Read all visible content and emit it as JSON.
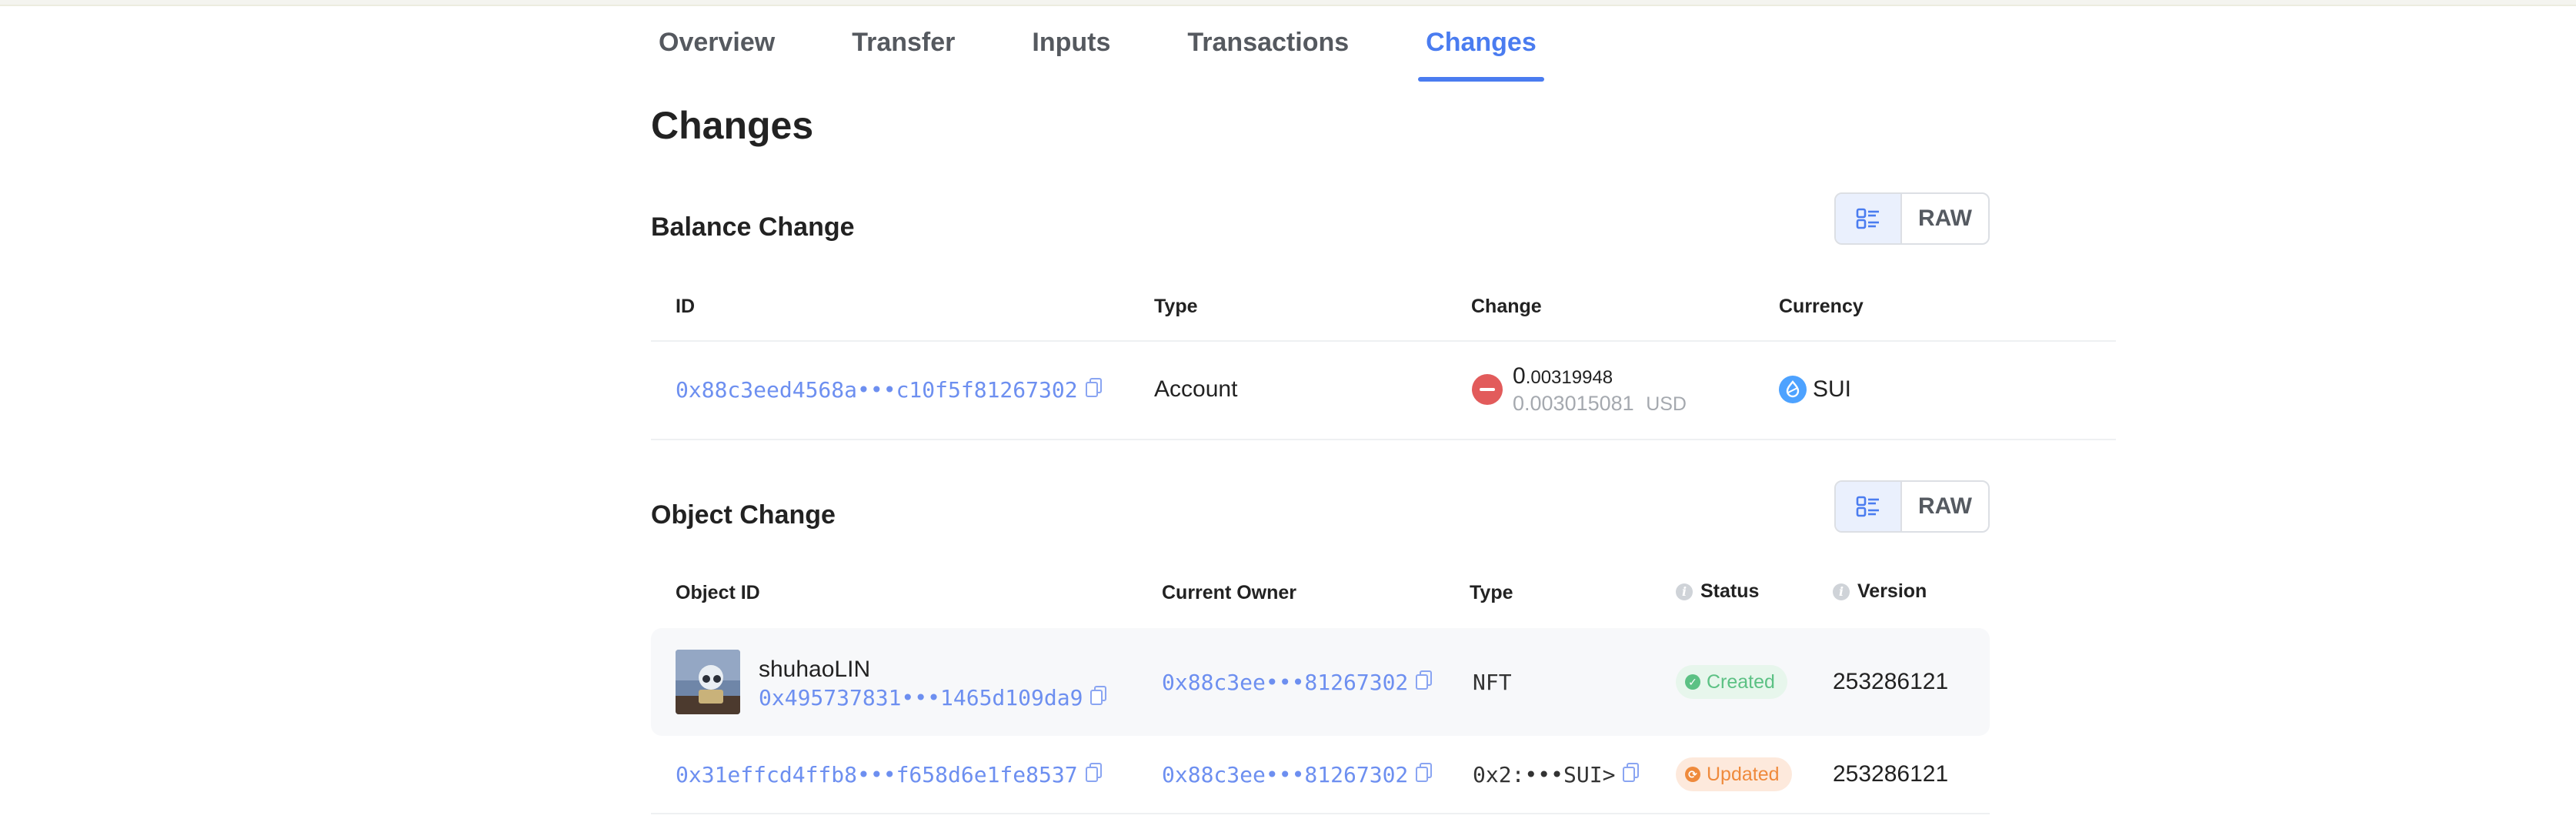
{
  "tabs": [
    {
      "label": "Overview",
      "active": false
    },
    {
      "label": "Transfer",
      "active": false
    },
    {
      "label": "Inputs",
      "active": false
    },
    {
      "label": "Transactions",
      "active": false
    },
    {
      "label": "Changes",
      "active": true
    }
  ],
  "page_title": "Changes",
  "balance": {
    "title": "Balance Change",
    "toggle_raw": "RAW",
    "headers": {
      "id": "ID",
      "type": "Type",
      "change": "Change",
      "currency": "Currency"
    },
    "row": {
      "id": "0x88c3eed4568a•••c10f5f81267302",
      "type": "Account",
      "change_int": "0",
      "change_frac": ".00319948",
      "usd_value": "0.003015081",
      "usd_label": "USD",
      "currency": "SUI"
    }
  },
  "object": {
    "title": "Object Change",
    "toggle_raw": "RAW",
    "headers": {
      "object_id": "Object ID",
      "owner": "Current Owner",
      "type": "Type",
      "status": "Status",
      "version": "Version"
    },
    "rows": [
      {
        "name": "shuhaoLIN",
        "object_id": "0x495737831•••1465d109da9",
        "owner": "0x88c3ee•••81267302",
        "type": "NFT",
        "status": "Created",
        "version": "253286121"
      },
      {
        "object_id": "0x31effcd4ffb8•••f658d6e1fe8537",
        "owner": "0x88c3ee•••81267302",
        "type": "0x2:•••SUI>",
        "status": "Updated",
        "version": "253286121"
      }
    ]
  },
  "colors": {
    "accent": "#4a7cf0",
    "link": "#6d8ff0",
    "created": "#5cc184",
    "updated": "#ef8a3c",
    "negative": "#e25b5b"
  }
}
